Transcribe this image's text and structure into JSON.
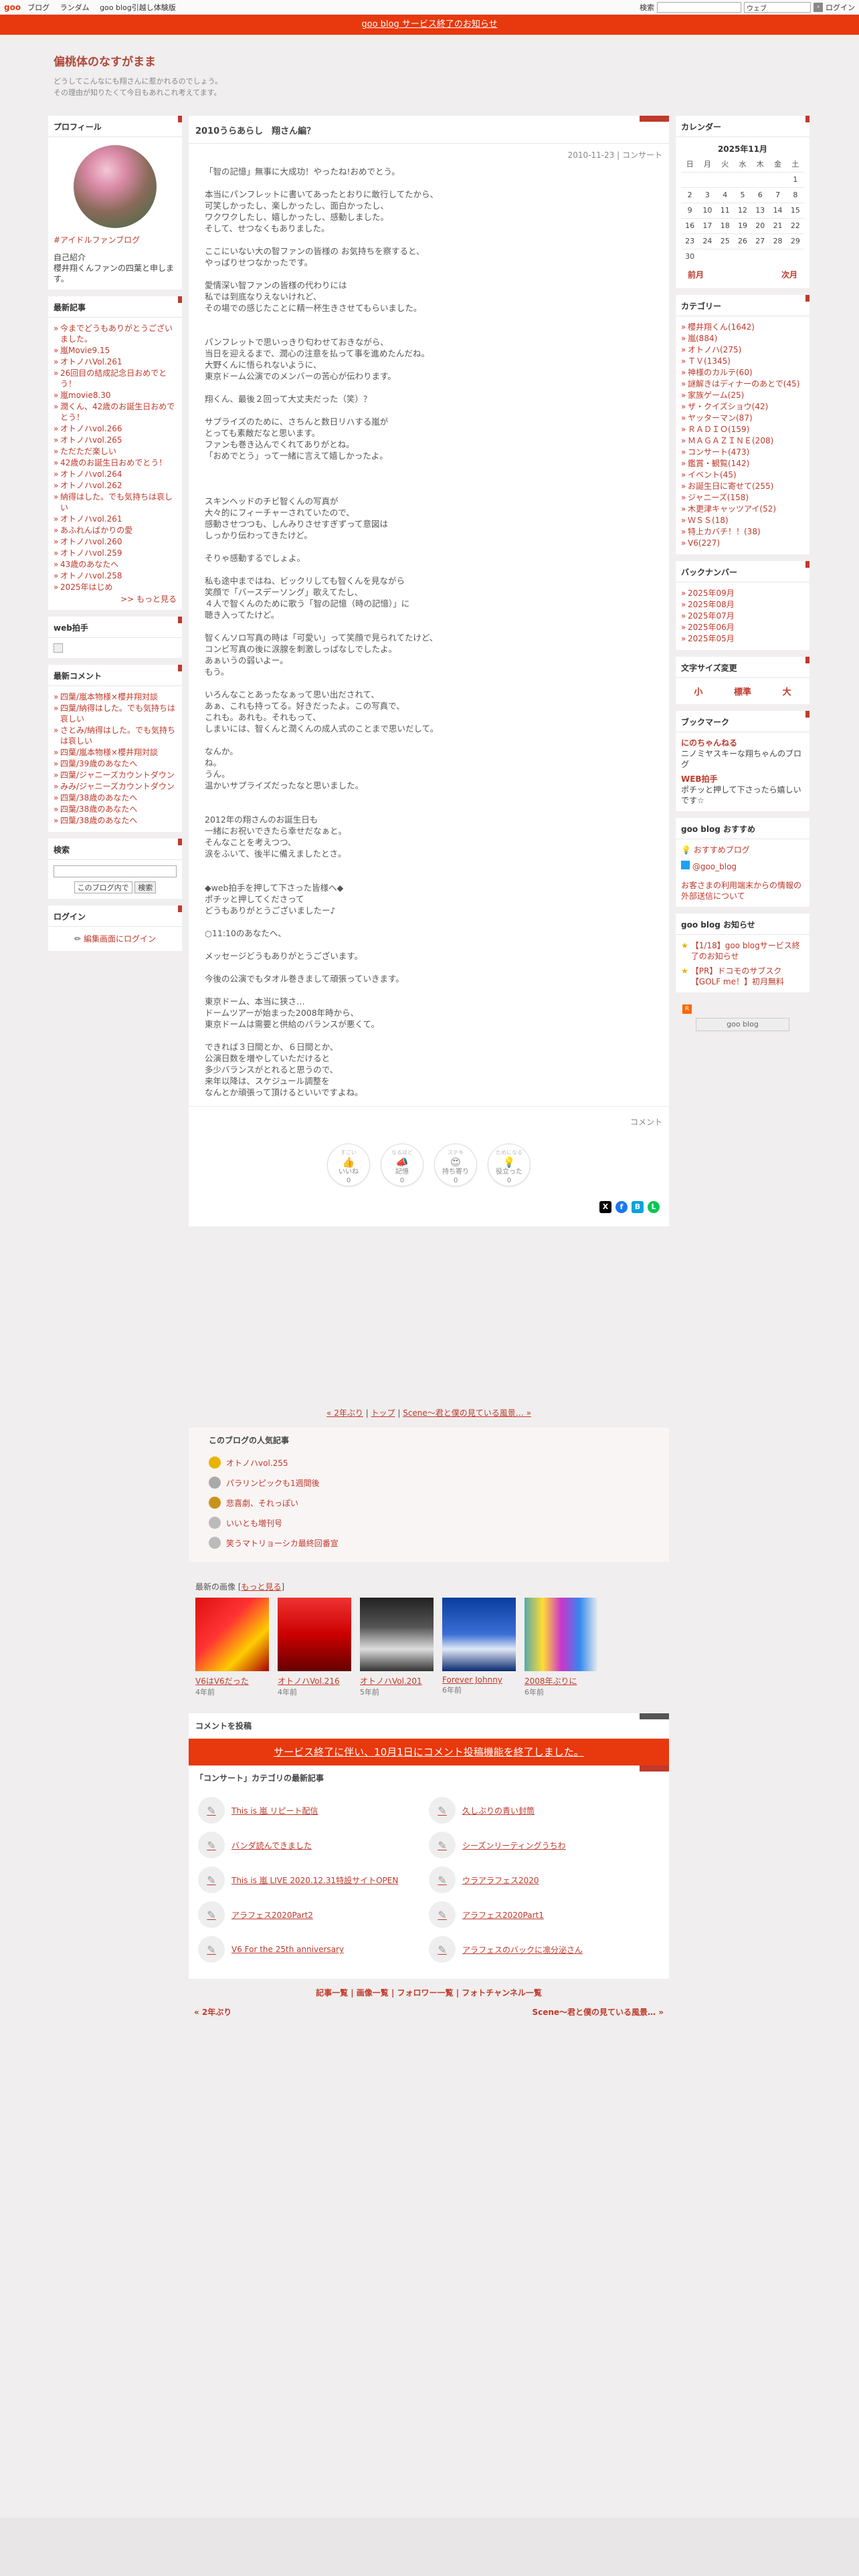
{
  "topbar": {
    "logo": "goo",
    "nav": [
      "ブログ",
      "ランダム",
      "goo blog引越し体験版"
    ],
    "search_label": "検索",
    "search_select": "ウェブ",
    "login": "ログイン"
  },
  "notice": "goo blog サービス終了のお知らせ",
  "header": {
    "title": "偏桃体のなすがまま",
    "desc1": "どうしてこんなにも翔さんに惹かれるのでしょう。",
    "desc2": "その理由が知りたくて今日もあれこれ考えてます。"
  },
  "profile": {
    "title": "プロフィール",
    "link": "#アイドルファンブログ",
    "intro_label": "自己紹介",
    "intro": "櫻井翔くんファンの四葉と申します。"
  },
  "recent": {
    "title": "最新記事",
    "items": [
      "今までどうもありがとうございました。",
      "嵐Movie9.15",
      "オトノハVol.261",
      "26回目の結成記念日おめでとう！",
      "嵐movie8.30",
      "潤くん、42歳のお誕生日おめでとう！",
      "オトノハvol.266",
      "オトノハvol.265",
      "ただただ楽しい",
      "42歳のお誕生日おめでとう！",
      "オトノハvol.264",
      "オトノハvol.262",
      "納得はした。でも気持ちは哀しい",
      "オトノハvol.261",
      "あふれんばかりの愛",
      "オトノハvol.260",
      "オトノハvol.259",
      "43歳のあなたへ",
      "オトノハvol.258",
      "2025年はじめ"
    ],
    "more": ">> もっと見る"
  },
  "webclap": {
    "title": "web拍手"
  },
  "comments": {
    "title": "最新コメント",
    "items": [
      "四葉/嵐本物様×櫻井翔対談",
      "四葉/納得はした。でも気持ちは哀しい",
      "さとみ/納得はした。でも気持ちは哀しい",
      "四葉/嵐本物様×櫻井翔対談",
      "四葉/39歳のあなたへ",
      "四葉/ジャニーズカウントダウン",
      "みみ/ジャニーズカウントダウン",
      "四葉/38歳のあなたへ",
      "四葉/38歳のあなたへ",
      "四葉/38歳のあなたへ"
    ]
  },
  "search": {
    "title": "検索",
    "select": "このブログ内で",
    "button": "検索"
  },
  "login": {
    "title": "ログイン",
    "link": "編集画面にログイン"
  },
  "article": {
    "title": "2010うらあらし　翔さん編？",
    "meta": "2010-11-23 | コンサート",
    "body": "「智の記憶」無事に大成功！やったね!おめでとう。\n\n本当にパンフレットに書いてあったとおりに敢行してたから、\n可笑しかったし、楽しかったし、面白かったし、\nワクワクしたし、嬉しかったし、感動しました。\nそして、せつなくもありました。\n\nここにいない大の智ファンの皆様の お気持ちを察すると、\nやっぱりせつなかったです。\n\n愛情深い智ファンの皆様の代わりには\n私では到底なりえないけれど、\nその場での感じたことに精一杯生きさせてもらいました。\n\n\nパンフレットで思いっきり匂わせておきながら、\n当日を迎えるまで、潤心の注意を払って事を進めたんだね。\n大野くんに悟られないように、\n東京ドーム公演でのメンバーの苦心が伝わります。\n\n翔くん、最後２回って大丈夫だった（笑）？\n\nサプライズのために、さちんと数日リハする嵐が\nとっても素敵だなと思います。\nファンも巻き込んでくれてありがとね。\n「おめでとう」って一緒に言えて嬉しかったよ。\n\n\n\nスキンヘッドのチビ智くんの写真が\n大々的にフィーチャーされていたので、\n感動させつつも、しんみりさせすぎずって意図は\nしっかり伝わってきたけど。\n\nそりゃ感動するでしょよ。\n\n私も途中まではね、ビックリしても智くんを見ながら\n笑顔で「バースデーソング」歌えてたし、\n４人で智くんのために歌う「智の記憶（時の記憶）」に\n聴き入ってたけど。\n\n智くんソロ写真の時は「可愛い」って笑顔で見られてたけど、\nコンビ写真の後に涙腺を刺激しっぱなしでしたよ。\nあぁいうの弱いよー。\nもう。\n\nいろんなことあったなぁって思い出だされて、\nあぁ、これも持ってる。好きだったよ。この写真で、\nこれも。あれも。それもって、\nしまいには、智くんと潤くんの成人式のことまで思いだして。\n\nなんか。\nね。\nうん。\n温かいサプライズだったなと思いました。\n\n\n2012年の翔さんのお誕生日も\n一緒にお祝いできたら幸せだなぁと。\nそんなことを考えつつ、\n涙をふいて、後半に備えましたとさ。\n\n\n◆web拍手を押して下さった皆様へ◆\nポチッと押してくださって\nどうもありがとうございましたー♪\n\n○11:10のあなたへ、\n\nメッセージどうもありがとうございます。\n\n今後の公演でもタオル巻きまして頑張っていきます。\n\n東京ドーム、本当に狭さ…\nドームツアーが始まった2008年時から、\n東京ドームは需要と供給のバランスが悪くて。\n\nできれば３日間とか、６日間とか、\n公演日数を増やしていただけると\n多少バランスがとれると思うので、\n来年以降は、スケジュール調整を\nなんとか頑張って頂けるといいですよね。",
    "comment_link": "コメント",
    "reactions": [
      {
        "label": "いいね",
        "emoji": "👍",
        "count": "0"
      },
      {
        "label": "記憶",
        "emoji": "📣",
        "count": "0"
      },
      {
        "label": "持ち寄り",
        "emoji": "😍",
        "count": "0"
      },
      {
        "label": "役立った",
        "emoji": "💡",
        "count": "0"
      }
    ],
    "reaction_hints": [
      "すごい",
      "なるほど",
      "ステキ",
      "ためになる"
    ]
  },
  "nav": {
    "prev": "« 2年ぶり",
    "top": "トップ",
    "next": "Scene〜君と僕の見ている風景… »"
  },
  "popular": {
    "title": "このブログの人気記事",
    "items": [
      "オトノハvol.255",
      "パラリンピックも1週間後",
      "悲喜劇、それっぽい",
      "いいとも増刊号",
      "笑うマトリョーシカ最終回番宣"
    ]
  },
  "images": {
    "title": "最新の画像",
    "more": "もっと見る",
    "items": [
      {
        "cap": "V6はV6だった",
        "age": "4年前"
      },
      {
        "cap": "オトノハVol.216",
        "age": "4年前"
      },
      {
        "cap": "オトノハVol.201",
        "age": "5年前"
      },
      {
        "cap": "Forever Johnny",
        "age": "6年前"
      },
      {
        "cap": "2008年ぶりに",
        "age": "6年前"
      }
    ]
  },
  "post": {
    "title": "コメントを投稿",
    "banner": "サービス終了に伴い、10月1日にコメント投稿機能を終了しました。",
    "category_title": "「コンサート」カテゴリの最新記事",
    "items": [
      "This is 嵐 リピート配信",
      "久しぶりの青い封筒",
      "バンダ読んできました",
      "シーズンリーティングうちわ",
      "This is 嵐 LIVE 2020.12.31特設サイトOPEN",
      "ウラアラフェス2020",
      "アラフェス2020Part2",
      "アラフェス2020Part1",
      "V6 For the 25th anniversary",
      "アラフェスのバックに凛分泌さん"
    ]
  },
  "bottom_links": "記事一覧 | 画像一覧 | フォロワー一覧 | フォトチャンネル一覧",
  "pager": {
    "prev": "« 2年ぶり",
    "next": "Scene〜君と僕の見ている風景… »"
  },
  "calendar": {
    "title": "カレンダー",
    "month": "2025年11月",
    "days": [
      "日",
      "月",
      "火",
      "水",
      "木",
      "金",
      "土"
    ],
    "cells": [
      "",
      "",
      "",
      "",
      "",
      "",
      "1",
      "2",
      "3",
      "4",
      "5",
      "6",
      "7",
      "8",
      "9",
      "10",
      "11",
      "12",
      "13",
      "14",
      "15",
      "16",
      "17",
      "18",
      "19",
      "20",
      "21",
      "22",
      "23",
      "24",
      "25",
      "26",
      "27",
      "28",
      "29",
      "30",
      "",
      "",
      "",
      "",
      "",
      ""
    ],
    "prev": "前月",
    "next": "次月"
  },
  "categories": {
    "title": "カテゴリー",
    "items": [
      "櫻井翔くん(1642)",
      "嵐(884)",
      "オトノハ(275)",
      "ＴＶ(1345)",
      "神様のカルテ(60)",
      "謎解きはディナーのあとで(45)",
      "家族ゲーム(25)",
      "ザ・クイズショウ(42)",
      "ヤッターマン(87)",
      "ＲＡＤＩＯ(159)",
      "ＭＡＧＡＺＩＮＥ(208)",
      "コンサート(473)",
      "鑑賞・観覧(142)",
      "イベント(45)",
      "お誕生日に寄せて(255)",
      "ジャニーズ(158)",
      "木更津キャッツアイ(52)",
      "ＷＳＳ(18)",
      "特上カバチ！！(38)",
      "V6(227)"
    ]
  },
  "backnumber": {
    "title": "バックナンバー",
    "items": [
      "2025年09月",
      "2025年08月",
      "2025年07月",
      "2025年06月",
      "2025年05月"
    ]
  },
  "fontsize": {
    "title": "文字サイズ変更",
    "small": "小",
    "mid": "標準",
    "large": "大"
  },
  "bookmark": {
    "title": "ブックマーク",
    "items": [
      {
        "name": "にのちゃんねる",
        "desc": "ニノミヤスキーな翔ちゃんのブログ"
      },
      {
        "name": "WEB拍手",
        "desc": "ポチッと押して下さったら嬉しいです☆"
      }
    ]
  },
  "recommend": {
    "title": "goo blog おすすめ",
    "item1": "おすすめブログ",
    "item2": "@goo_blog",
    "note": "お客さまの利用端末からの情報の外部送信について"
  },
  "announce": {
    "title": "goo blog お知らせ",
    "items": [
      "【1/18】goo blogサービス終了のお知らせ",
      "【PR】ドコモのサブスク【GOLF me！】初月無料"
    ]
  },
  "badge": "goo blog"
}
